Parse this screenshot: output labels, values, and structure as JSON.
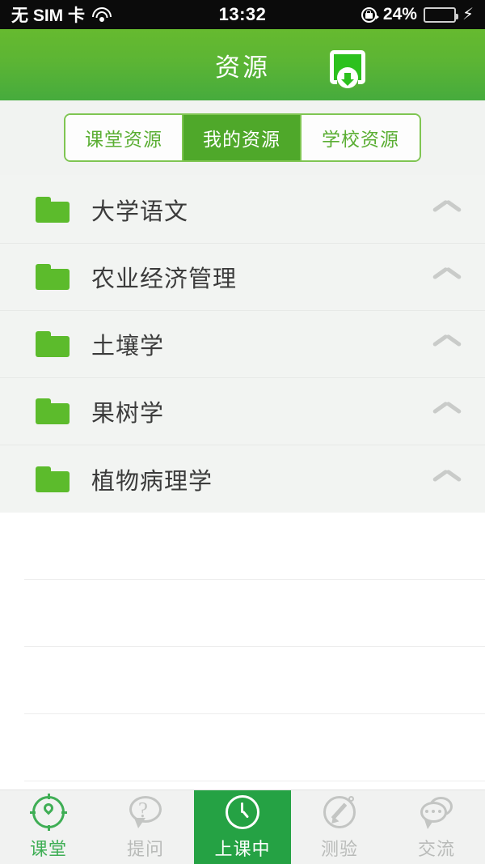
{
  "status_bar": {
    "carrier": "无 SIM 卡",
    "wifi_icon": "wifi-icon",
    "time": "13:32",
    "rotation_lock_icon": "rotation-lock-icon",
    "battery_percent": "24%",
    "battery_level": 24,
    "charging_icon": "lightning-bolt-icon"
  },
  "header": {
    "title": "资源",
    "download_icon": "download-icon",
    "background_color": "#5cb534"
  },
  "segmented_tabs": {
    "items": [
      {
        "label": "课堂资源",
        "selected": false
      },
      {
        "label": "我的资源",
        "selected": true
      },
      {
        "label": "学校资源",
        "selected": false
      }
    ],
    "accent_color": "#4fa82a"
  },
  "resource_list": {
    "items": [
      {
        "name": "大学语文",
        "icon": "folder-icon",
        "toggle_icon": "chevron-up-icon"
      },
      {
        "name": "农业经济管理",
        "icon": "folder-icon",
        "toggle_icon": "chevron-up-icon"
      },
      {
        "name": "土壤学",
        "icon": "folder-icon",
        "toggle_icon": "chevron-up-icon"
      },
      {
        "name": "果树学",
        "icon": "folder-icon",
        "toggle_icon": "chevron-up-icon"
      },
      {
        "name": "植物病理学",
        "icon": "folder-icon",
        "toggle_icon": "chevron-up-icon"
      }
    ],
    "folder_color": "#5cbb2c",
    "background_color": "#f2f4f2"
  },
  "empty_rows": {
    "count": 4
  },
  "bottom_nav": {
    "items": [
      {
        "label": "课堂",
        "icon": "compass-icon",
        "state": "active-green"
      },
      {
        "label": "提问",
        "icon": "question-bubble-icon",
        "state": "inactive"
      },
      {
        "label": "上课中",
        "icon": "clock-icon",
        "state": "selected"
      },
      {
        "label": "测验",
        "icon": "pencil-circle-icon",
        "state": "inactive"
      },
      {
        "label": "交流",
        "icon": "chat-bubbles-icon",
        "state": "inactive"
      }
    ],
    "selected_color": "#25a244",
    "inactive_color": "#b9bbb9"
  }
}
